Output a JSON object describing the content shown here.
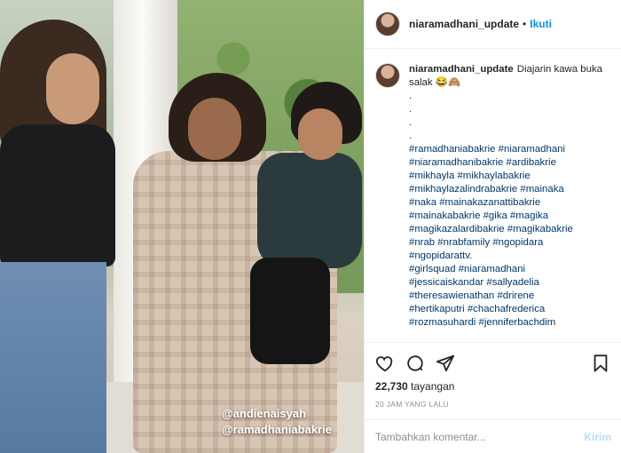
{
  "header": {
    "username": "niaramadhani_update",
    "separator": "•",
    "follow_label": "Ikuti"
  },
  "caption": {
    "username": "niaramadhani_update",
    "text": "Diajarin kawa buka salak 😂🙈",
    "dots": [
      ".",
      ".",
      ".",
      "."
    ],
    "hashtags": [
      "#ramadhaniabakrie #niaramadhani",
      "#niaramadhanibakrie #ardibakrie",
      "#mikhayla #mikhaylabakrie",
      "#mikhaylazalindrabakrie #mainaka",
      "#naka #mainakazanattibakrie",
      "#mainakabakrie #gika #magika",
      "#magikazalardibakrie #magikabakrie",
      "#nrab #nrabfamily #ngopidara",
      "#ngopidarattv.",
      "#girlsquad #niaramadhani",
      "#jessicaiskandar #sallyadelia",
      "#theresawienathan #drirene",
      "#hertikaputri #chachafrederica",
      "#rozmasuhardi #jenniferbachdim"
    ]
  },
  "media": {
    "tags": [
      "@andienaisyah",
      "@ramadhaniabakrie"
    ]
  },
  "actions": {
    "icons": [
      "heart-icon",
      "comment-icon",
      "share-icon",
      "bookmark-icon"
    ],
    "views_count": "22,730",
    "views_label": "tayangan",
    "time_ago": "20 JAM YANG LALU"
  },
  "comment": {
    "placeholder": "Tambahkan komentar...",
    "post_label": "Kirim"
  }
}
